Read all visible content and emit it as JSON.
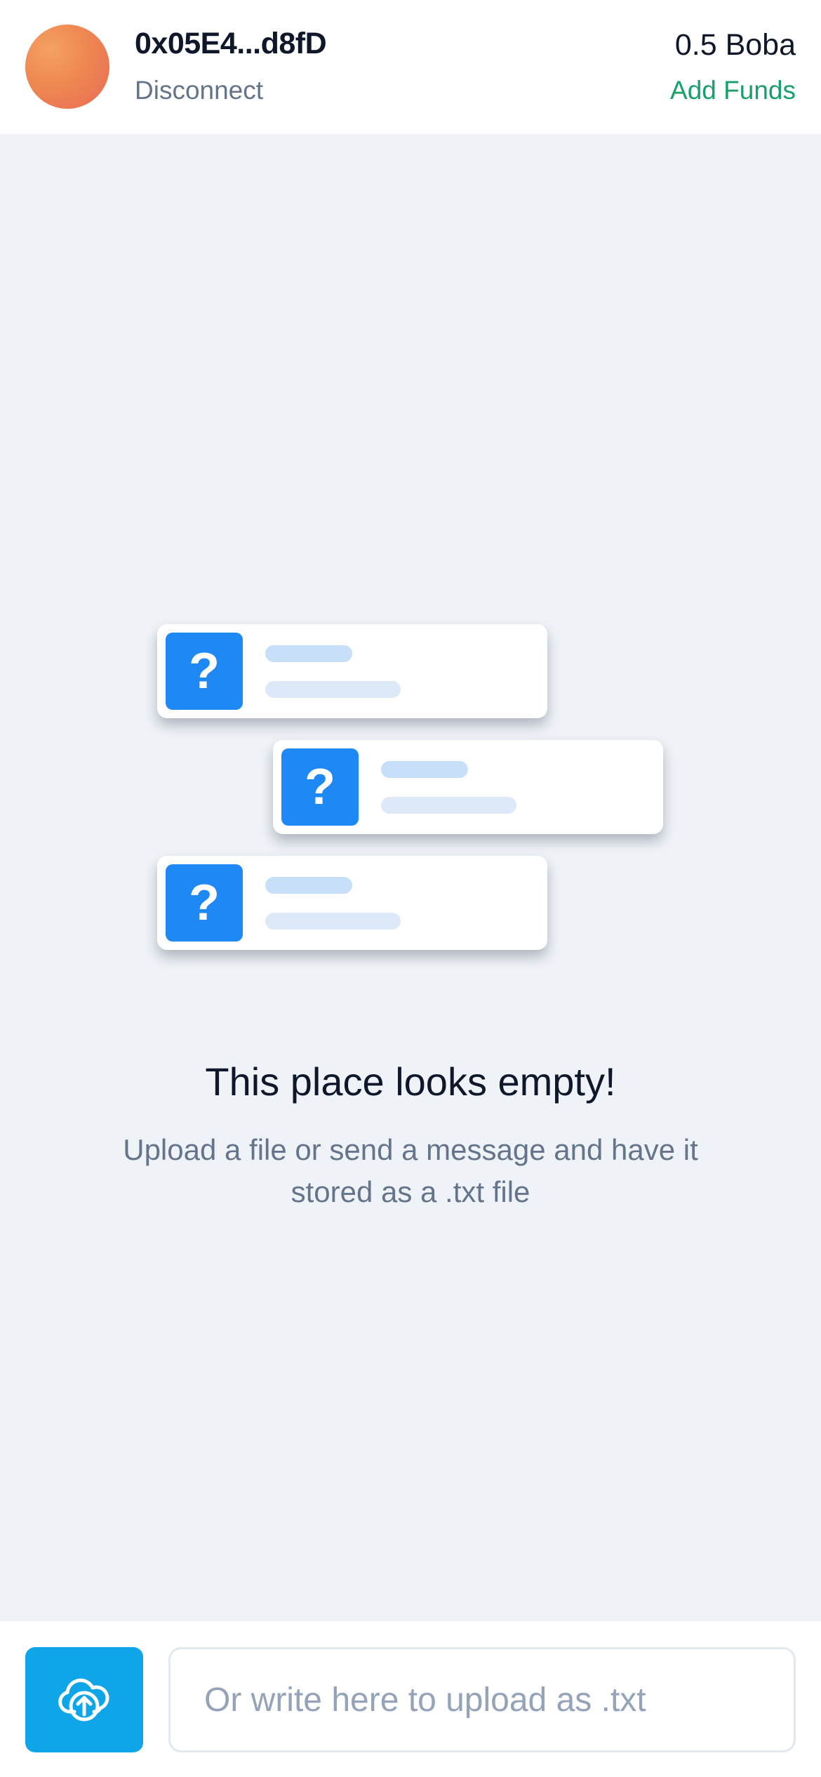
{
  "header": {
    "address": "0x05E4...d8fD",
    "disconnect_label": "Disconnect",
    "balance": "0.5 Boba",
    "add_funds_label": "Add Funds"
  },
  "illustration": {
    "cards": [
      {
        "icon": "question-icon",
        "glyph": "?"
      },
      {
        "icon": "question-icon",
        "glyph": "?"
      },
      {
        "icon": "question-icon",
        "glyph": "?"
      }
    ]
  },
  "empty_state": {
    "title": "This place looks empty!",
    "subtitle": "Upload a file or send a message and have it stored as a .txt file"
  },
  "composer": {
    "upload_icon": "cloud-upload-icon",
    "input_placeholder": "Or write here to upload as .txt",
    "input_value": ""
  },
  "colors": {
    "accent_blue": "#1e88f5",
    "upload_blue": "#0ea5e9",
    "add_funds_green": "#16a06a",
    "background": "#eff3f8"
  }
}
